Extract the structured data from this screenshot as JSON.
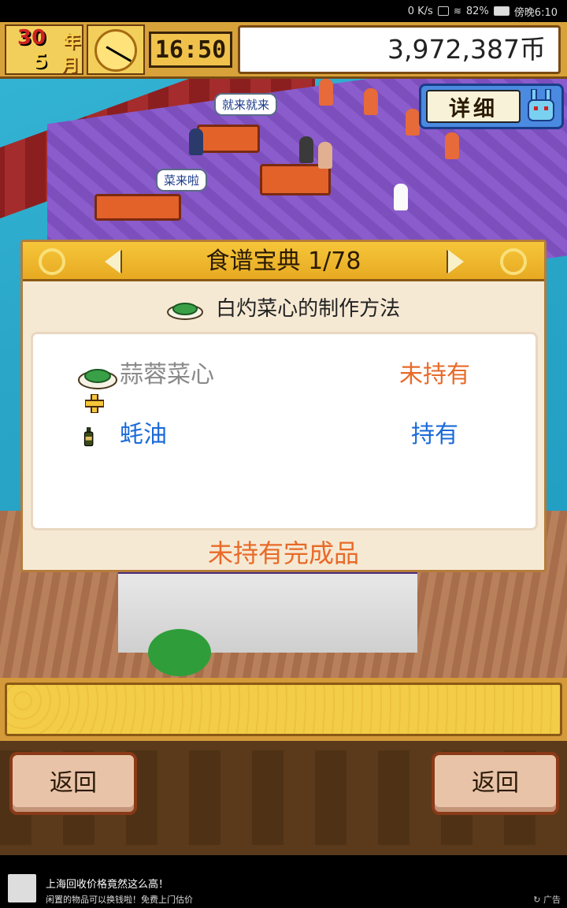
{
  "status_bar": {
    "net_speed": "0 K/s",
    "battery": "82%",
    "time": "傍晚6:10"
  },
  "hud": {
    "day": "30",
    "day_unit": "年",
    "month": "5",
    "month_unit": "月",
    "time": "16:50",
    "money": "3,972,387币"
  },
  "detail_button": {
    "label": "详细"
  },
  "speech_bubbles": [
    "就来就来",
    "菜来啦"
  ],
  "recipe_dialog": {
    "title": "食谱宝典 1/78",
    "dish_title": "白灼菜心的制作方法",
    "ingredients": [
      {
        "name": "蒜蓉菜心",
        "status": "未持有",
        "name_color": "#8a8a8a",
        "status_color": "#e86a28",
        "icon": "dish-icon"
      },
      {
        "name": "蚝油",
        "status": "持有",
        "name_color": "#1a6ad8",
        "status_color": "#1a6ad8",
        "icon": "bottle-icon"
      }
    ],
    "footer": "未持有完成品",
    "footer_color": "#e86a28"
  },
  "menu": {
    "back_left_label": "返回",
    "back_right_label": "返回"
  },
  "ad": {
    "title": "上海回收价格竟然这么高！",
    "subtitle": "闲置的物品可以换钱啦！免费上门估价",
    "tag": "广告"
  }
}
